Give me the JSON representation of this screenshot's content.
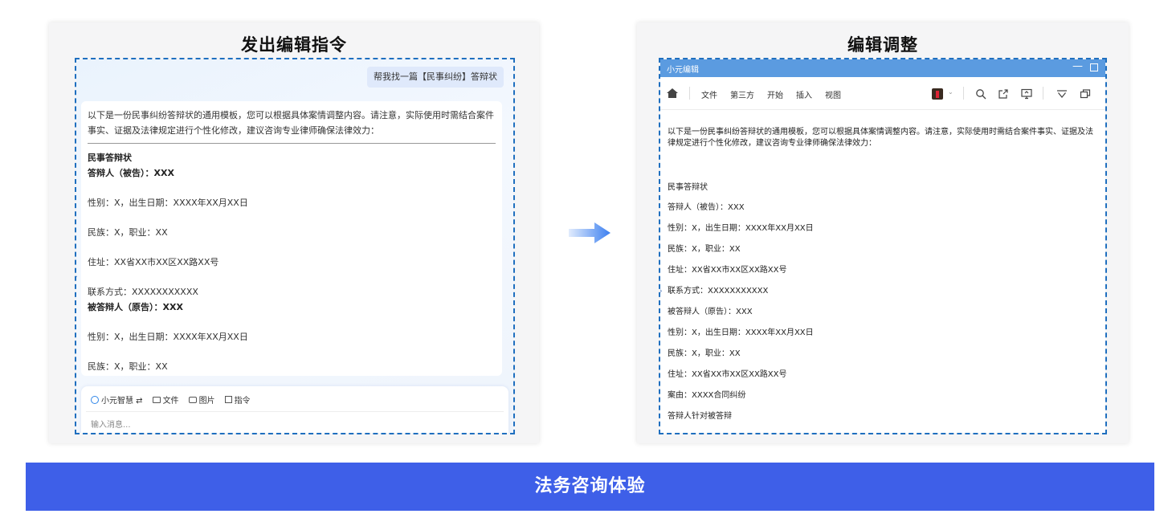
{
  "left_panel": {
    "title": "发出编辑指令",
    "user_message": "帮我找一篇【民事纠纷】答辩状",
    "reply": {
      "intro": "以下是一份民事纠纷答辩状的通用模板，您可以根据具体案情调整内容。请注意，实际使用时需结合案件事实、证据及法律规定进行个性化修改，建议咨询专业律师确保法律效力：",
      "doc_title": "民事答辩状",
      "respondent": "答辩人（被告）：XXX",
      "gender_birth": "性别：X，出生日期：XXXX年XX月XX日",
      "ethnicity_job": "民族：X，职业：XX",
      "address": "住址：XX省XX市XX区XX路XX号",
      "contact": "联系方式：XXXXXXXXXXX",
      "plaintiff": "被答辩人（原告）：XXX",
      "gender_birth_2": "性别：X，出生日期：XXXX年XX月XX日",
      "ethnicity_job_2": "民族：X，职业：XX"
    },
    "input_tools": {
      "smart": "小元智慧 ⇄",
      "file": "文件",
      "image": "图片",
      "command": "指令"
    },
    "input_placeholder": "输入消息..."
  },
  "right_panel": {
    "title": "编辑调整",
    "window_title": "小元编辑",
    "menu": [
      "文件",
      "第三方",
      "开始",
      "插入",
      "视图"
    ],
    "doc": {
      "intro": "以下是一份民事纠纷答辩状的通用模板，您可以根据具体案情调整内容。请注意，实际使用时需结合案件事实、证据及法律规定进行个性化修改，建议咨询专业律师确保法律效力：",
      "title": "民事答辩状",
      "lines": [
        "答辩人（被告）：XXX",
        "性别：X，出生日期：XXXX年XX月XX日",
        "民族：X，职业：XX",
        "住址：XX省XX市XX区XX路XX号",
        "联系方式：XXXXXXXXXXX",
        "被答辩人（原告）：XXX",
        "性别：X，出生日期：XXXX年XX月XX日",
        "民族：X，职业：XX",
        "住址：XX省XX市XX区XX路XX号",
        "案由：XXXX合同纠纷",
        "答辩人针对被答辩"
      ]
    }
  },
  "footer": {
    "label": "法务咨询体验"
  },
  "colors": {
    "dash_border": "#1f6fbf",
    "titlebar": "#5b9be0",
    "footer": "#3e5fe8",
    "arrow": "#3b7ff0"
  }
}
